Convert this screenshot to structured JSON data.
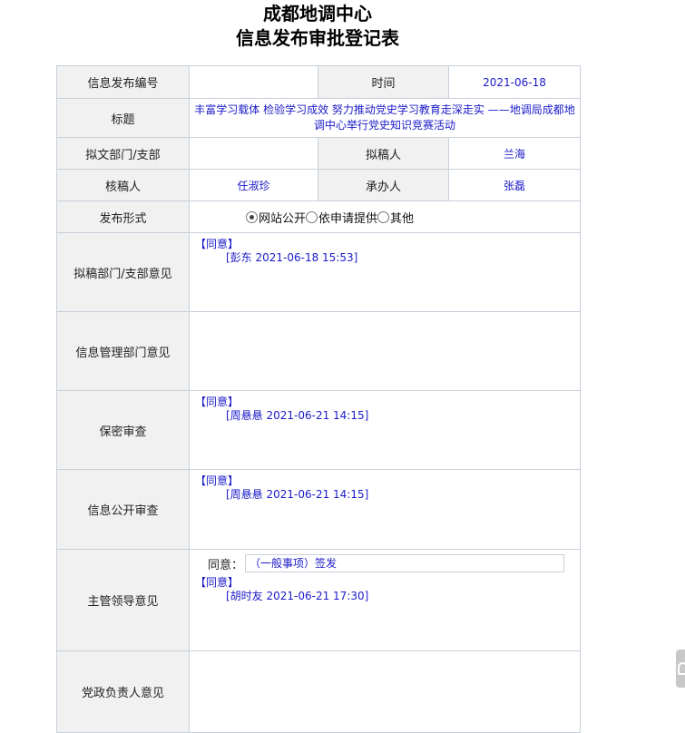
{
  "page": {
    "title_line1": "成都地调中心",
    "title_line2": "信息发布审批登记表"
  },
  "form": {
    "info_no": {
      "label": "信息发布编号",
      "value": ""
    },
    "time": {
      "label": "时间",
      "value": "2021-06-18"
    },
    "title": {
      "label": "标题",
      "value": "丰富学习载体 检验学习成效 努力推动党史学习教育走深走实 ——地调局成都地调中心举行党史知识竞赛活动"
    },
    "dept": {
      "label": "拟文部门/支部",
      "value": ""
    },
    "drafter": {
      "label": "拟稿人",
      "value": "兰海"
    },
    "reviewer": {
      "label": "核稿人",
      "value": "任淑珍"
    },
    "handler": {
      "label": "承办人",
      "value": "张磊"
    },
    "publish_form": {
      "label": "发布形式",
      "options": [
        {
          "label": "网站公开",
          "checked": true
        },
        {
          "label": "依申请提供",
          "checked": false
        },
        {
          "label": "其他",
          "checked": false
        }
      ]
    }
  },
  "opinions": {
    "draft_dept": {
      "label": "拟稿部门/支部意见",
      "status": "【同意】",
      "sign": "[彭东 2021-06-18 15:53]"
    },
    "info_mgmt": {
      "label": "信息管理部门意见"
    },
    "secrecy": {
      "label": "保密审查",
      "status": "【同意】",
      "sign": "[周悬悬 2021-06-21 14:15]"
    },
    "disclosure": {
      "label": "信息公开审查",
      "status": "【同意】",
      "sign": "[周悬悬 2021-06-21 14:15]"
    },
    "leader": {
      "label": "主管领导意见",
      "agree_label": "同意：",
      "agree_value": "（一般事项）签发",
      "status": "【同意】",
      "sign": "[胡时友 2021-06-21 17:30]"
    },
    "party": {
      "label": "党政负责人意见"
    }
  }
}
